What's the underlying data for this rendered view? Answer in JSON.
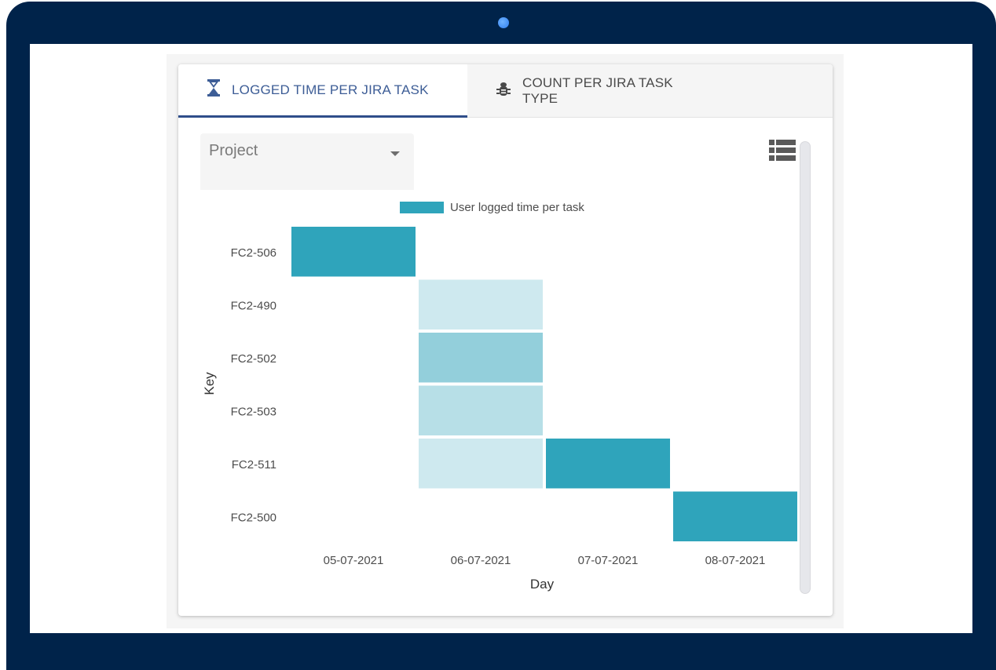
{
  "tabs": [
    {
      "label": "LOGGED TIME PER JIRA TASK",
      "icon": "hourglass-icon",
      "active": true
    },
    {
      "label": "COUNT PER JIRA TASK TYPE",
      "icon": "bug-icon",
      "active": false
    }
  ],
  "filter": {
    "label": "Project"
  },
  "colors": {
    "frame": "#00234a",
    "active_tab": "#3d5d96",
    "heat_max": "#2fa4bb",
    "heat_min": "#e4f2f6"
  },
  "chart_data": {
    "type": "heatmap",
    "legend": "User logged time per task",
    "xlabel": "Day",
    "ylabel": "Key",
    "x": [
      "05-07-2021",
      "06-07-2021",
      "07-07-2021",
      "08-07-2021"
    ],
    "y": [
      "FC2-506",
      "FC2-490",
      "FC2-502",
      "FC2-503",
      "FC2-511",
      "FC2-500"
    ],
    "cells": [
      {
        "x": "05-07-2021",
        "y": "FC2-506",
        "value": 1.0
      },
      {
        "x": "06-07-2021",
        "y": "FC2-490",
        "value": 0.12
      },
      {
        "x": "06-07-2021",
        "y": "FC2-502",
        "value": 0.45
      },
      {
        "x": "06-07-2021",
        "y": "FC2-503",
        "value": 0.25
      },
      {
        "x": "06-07-2021",
        "y": "FC2-511",
        "value": 0.12
      },
      {
        "x": "07-07-2021",
        "y": "FC2-511",
        "value": 1.0
      },
      {
        "x": "08-07-2021",
        "y": "FC2-500",
        "value": 1.0
      }
    ]
  }
}
